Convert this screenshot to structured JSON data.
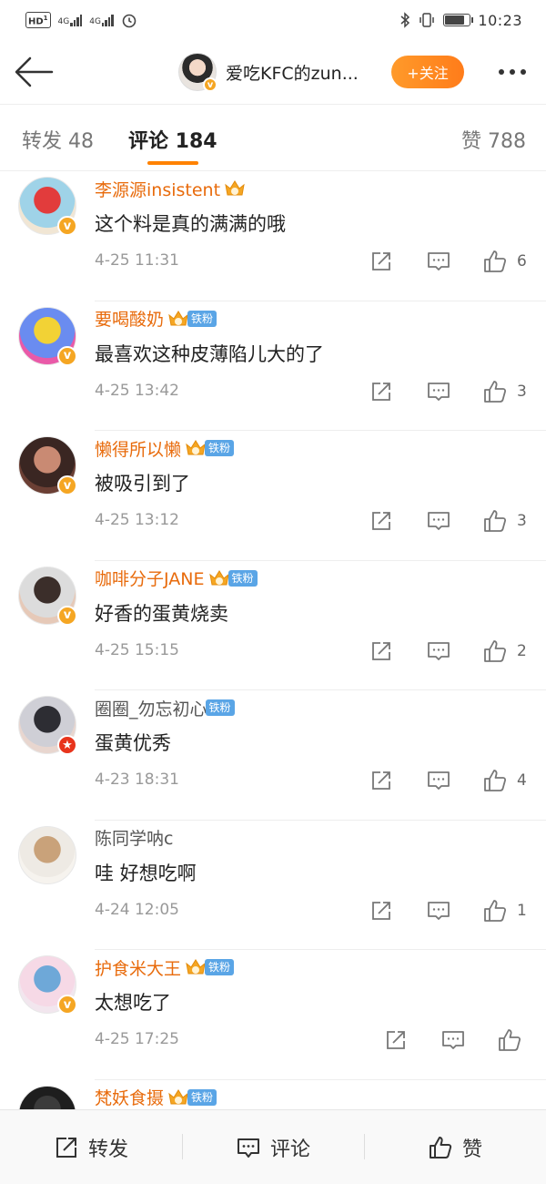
{
  "status_bar": {
    "hd": "HD",
    "sim_1": "1",
    "net_1": "4G",
    "net_2": "4G",
    "time": "10:23"
  },
  "header": {
    "author_name": "爱吃KFC的zun...",
    "follow_label": "+关注"
  },
  "tabs": {
    "repost": "转发 48",
    "comment": "评论 184",
    "like": "赞 788"
  },
  "comments": [
    {
      "name": "李源源insistent",
      "name_style": "vip",
      "crown_level": "5",
      "fan_badge": "",
      "text": "这个料是真的满满的哦",
      "time": "4-25 11:31",
      "likes": "6",
      "verify": "gold",
      "avatar_colors": [
        "#9fd3e8",
        "#e23c3c",
        "#f1e6d4"
      ]
    },
    {
      "name": "要喝酸奶",
      "name_style": "vip",
      "crown_level": "",
      "fan_badge": "铁粉",
      "text": "最喜欢这种皮薄陷儿大的了",
      "time": "4-25 13:42",
      "likes": "3",
      "verify": "gold",
      "avatar_colors": [
        "#6a8cf0",
        "#f2d235",
        "#e95aa8"
      ]
    },
    {
      "name": "懒得所以懒",
      "name_style": "vip",
      "crown_level": "5",
      "fan_badge": "铁粉",
      "text": "被吸引到了",
      "time": "4-25 13:12",
      "likes": "3",
      "verify": "gold",
      "avatar_colors": [
        "#3a2622",
        "#c98a73",
        "#6b3f34"
      ]
    },
    {
      "name": "咖啡分子JANE",
      "name_style": "vip",
      "crown_level": "5",
      "fan_badge": "铁粉",
      "text": "好香的蛋黄烧卖",
      "time": "4-25 15:15",
      "likes": "2",
      "verify": "gold",
      "avatar_colors": [
        "#dcdcdc",
        "#3b2e2a",
        "#e6c9b8"
      ]
    },
    {
      "name": "圈圈_勿忘初心",
      "name_style": "plain",
      "crown_level": "",
      "fan_badge": "铁粉",
      "text": "蛋黄优秀",
      "time": "4-23 18:31",
      "likes": "4",
      "verify": "red",
      "avatar_colors": [
        "#cfcfd6",
        "#2d2d33",
        "#e8d6cf"
      ]
    },
    {
      "name": "陈同学呐c",
      "name_style": "plain",
      "crown_level": "",
      "fan_badge": "",
      "text": "哇 好想吃啊",
      "time": "4-24 12:05",
      "likes": "1",
      "verify": "",
      "avatar_colors": [
        "#eeeae4",
        "#c9a27a",
        "#f6f3ee"
      ]
    },
    {
      "name": "护食米大王",
      "name_style": "vip",
      "crown_level": "6",
      "fan_badge": "铁粉",
      "text": "太想吃了",
      "time": "4-25 17:25",
      "likes": "",
      "verify": "gold",
      "avatar_colors": [
        "#f6d9e6",
        "#6ea8d8",
        "#f2e6ee"
      ]
    },
    {
      "name": "梵妖食摄",
      "name_style": "vip",
      "crown_level": "5",
      "fan_badge": "铁粉",
      "text": "",
      "time": "",
      "likes": "",
      "verify": "",
      "avatar_colors": [
        "#1e1e1e",
        "#3b3b3b",
        "#555555"
      ]
    }
  ],
  "bottom_bar": {
    "repost": "转发",
    "comment": "评论",
    "like": "赞"
  },
  "colors": {
    "accent": "#ff8200",
    "vip_name": "#e86b0c",
    "fan_badge": "#5aa5e6",
    "verify_gold": "#f5a623",
    "verify_red": "#e8341c"
  }
}
